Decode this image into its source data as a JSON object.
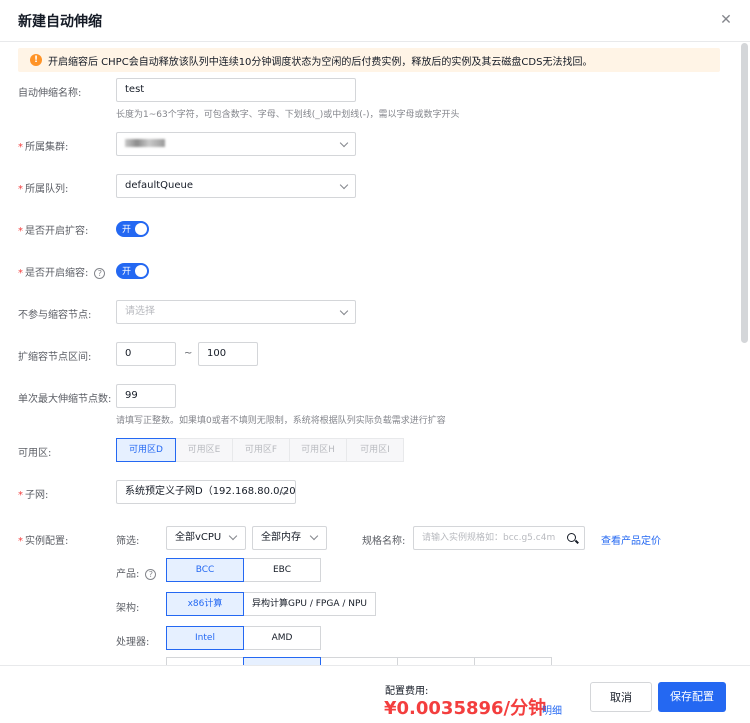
{
  "dialog": {
    "title": "新建自动伸缩",
    "close_icon": "close-icon"
  },
  "alert": {
    "icon": "warning-icon",
    "text": "开启缩容后 CHPC会自动释放该队列中连续10分钟调度状态为空闲的后付费实例，释放后的实例及其云磁盘CDS无法找回。"
  },
  "form": {
    "name": {
      "label": "自动伸缩名称:",
      "value": "test",
      "hint": "长度为1~63个字符，可包含数字、字母、下划线(_)或中划线(-)，需以字母或数字开头"
    },
    "cluster": {
      "label": "所属集群:",
      "value": ""
    },
    "queue": {
      "label": "所属队列:",
      "value": "defaultQueue"
    },
    "scale_out": {
      "label": "是否开启扩容:",
      "switch_text": "开"
    },
    "scale_in": {
      "label": "是否开启缩容:",
      "switch_text": "开"
    },
    "exclude_nodes": {
      "label": "不参与缩容节点:",
      "placeholder": "请选择"
    },
    "node_range": {
      "label": "扩缩容节点区间:",
      "min": "0",
      "sep": "~",
      "max": "100"
    },
    "max_step": {
      "label": "单次最大伸缩节点数:",
      "value": "99",
      "hint": "请填写正整数。如果填0或者不填则无限制，系统将根据队列实际负载需求进行扩容"
    },
    "zone": {
      "label": "可用区:",
      "options": [
        "可用区D",
        "可用区E",
        "可用区F",
        "可用区H",
        "可用区I"
      ],
      "selected": 0
    },
    "subnet": {
      "label": "子网:",
      "value": "系统预定义子网D（192.168.80.0/20"
    },
    "instance": {
      "label": "实例配置:",
      "filter_label": "筛选:",
      "vcpu": "全部vCPU",
      "memory": "全部内存",
      "spec_label": "规格名称:",
      "spec_placeholder": "请输入实例规格如：bcc.g5.c4m",
      "price_link": "查看产品定价",
      "product_label": "产品:",
      "products": [
        "BCC",
        "EBC"
      ],
      "arch_label": "架构:",
      "archs": [
        "x86计算",
        "异构计算GPU / FPGA / NPU"
      ],
      "cpu_label": "处理器:",
      "cpus": [
        "Intel",
        "AMD"
      ]
    }
  },
  "footer": {
    "fee_label": "配置费用:",
    "fee": "¥0.0035896/分钟",
    "detail_link": "明细",
    "cancel": "取消",
    "save": "保存配置"
  }
}
